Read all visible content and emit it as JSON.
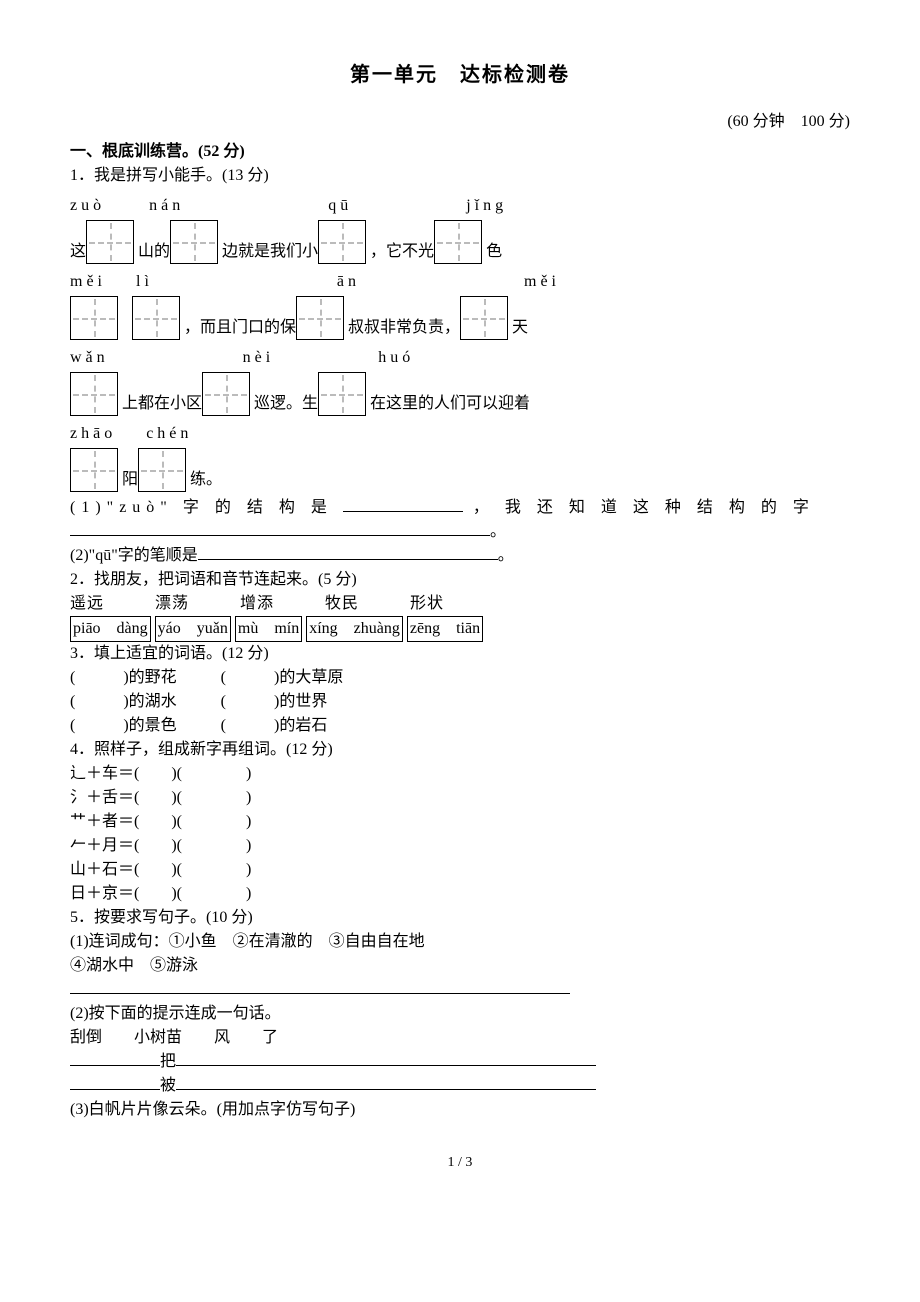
{
  "title": "第一单元　达标检测卷",
  "time_score": "(60 分钟　100 分)",
  "s1": {
    "head": "一、根底训练营。(52 分)",
    "q1": {
      "head": "1．我是拼写小能手。(13 分)",
      "py": {
        "zuo": "zuò",
        "nan": "nán",
        "qu": "qū",
        "jing": "jǐng",
        "mei1": "měi",
        "li": "lì",
        "an": "ān",
        "mei2": "měi",
        "wan": "wǎn",
        "nei": "nèi",
        "huo": "huó",
        "zhao": "zhāo",
        "chen": "chén"
      },
      "t": {
        "a1": "这",
        "a2": "山的",
        "a3": "边就是我们小",
        "a4": "，它不光",
        "a5": "色",
        "b1": "，而且门口的保",
        "b2": "叔叔非常负责，",
        "b3": "天",
        "c1": "上都在小区",
        "c2": "巡逻。生",
        "c3": "在这里的人们可以迎着",
        "d1": "阳",
        "d2": "练。"
      },
      "sub1a": "(1)\"zu",
      "sub1b": "ò",
      "sub1c": "\" 字 的 结 构 是 ",
      "sub1d": " ， 我 还 知 道 这 种 结 构 的 字",
      "sub1e": "。",
      "sub2a": "(2)\"qū\"字的笔顺是",
      "sub2b": "。"
    },
    "q2": {
      "head": "2．找朋友，把词语和音节连起来。(5 分)",
      "words": "遥远　　　漂荡　　　增添　　　牧民　　　形状",
      "p1": "piāo　dàng",
      "p2": "yáo　yuǎn",
      "p3": "mù　mín",
      "p4": "xíng　zhuàng",
      "p5": "zēng　tiān"
    },
    "q3": {
      "head": "3．填上适宜的词语。(12 分)",
      "l1a": "(　　　)的野花",
      "l1b": "(　　　)的大草原",
      "l2a": "(　　　)的湖水",
      "l2b": "(　　　)的世界",
      "l3a": "(　　　)的景色",
      "l3b": "(　　　)的岩石"
    },
    "q4": {
      "head": "4．照样子，组成新字再组词。(12 分)",
      "r1": "辶＋车＝(　　)(　　　　)",
      "r2": "氵＋舌＝(　　)(　　　　)",
      "r3": "艹＋者＝(　　)(　　　　)",
      "r4": "𠂉＋月＝(　　)(　　　　)",
      "r5": "山＋石＝(　　)(　　　　)",
      "r6": "日＋京＝(　　)(　　　　)"
    },
    "q5": {
      "head": "5．按要求写句子。(10 分)",
      "s1a": "(1)连词成句：①小鱼　②在清澈的　③自由自在地",
      "s1b": "④湖水中　⑤游泳",
      "s2a": "(2)按下面的提示连成一句话。",
      "s2b": "刮倒　　小树苗　　风　　了",
      "s2c_mid": "把",
      "s2d_mid": "被",
      "s3": "(3)白帆片片像云朵。(用加点字仿写句子)"
    }
  },
  "footer": "1 / 3"
}
